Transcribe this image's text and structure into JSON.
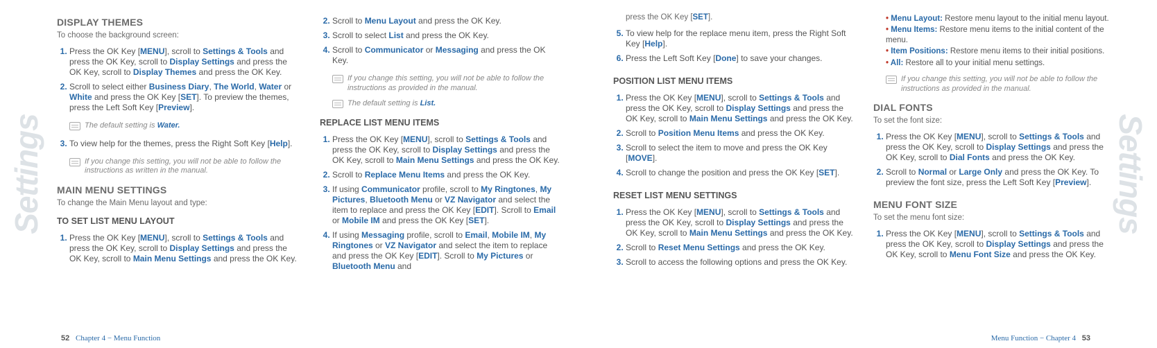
{
  "side_label_left": "Settings",
  "side_label_right": "Settings",
  "page_left_num": "52",
  "page_right_num": "53",
  "footer_left": "Chapter 4 − Menu Function",
  "footer_right": "Menu Function − Chapter 4",
  "dt_title": "DISPLAY THEMES",
  "dt_lead": "To choose the background screen:",
  "dt_s1_a": "Press the OK Key [",
  "dt_s1_b": "MENU",
  "dt_s1_c": "], scroll to ",
  "dt_s1_d": "Settings & Tools",
  "dt_s1_e": " and press the OK Key, scroll to ",
  "dt_s1_f": "Display Settings",
  "dt_s1_g": " and press the OK Key, scroll to ",
  "dt_s1_h": "Display Themes",
  "dt_s1_i": " and press the OK Key.",
  "dt_s2_a": "Scroll to select either ",
  "dt_s2_b": "Business Diary",
  "dt_s2_c": ", ",
  "dt_s2_d": "The World",
  "dt_s2_e": ", ",
  "dt_s2_f": "Water",
  "dt_s2_g": " or ",
  "dt_s2_h": "White",
  "dt_s2_i": " and press the OK Key [",
  "dt_s2_j": "SET",
  "dt_s2_k": "]. To preview the themes, press the Left Soft Key [",
  "dt_s2_l": "Preview",
  "dt_s2_m": "].",
  "dt_note1a": "The default setting is ",
  "dt_note1b": "Water.",
  "dt_s3_a": "To view help for the themes, press the Right Soft Key [",
  "dt_s3_b": "Help",
  "dt_s3_c": "].",
  "dt_note2": "If you change this setting, you will not be able to follow the instructions as written in the manual.",
  "mm_title": "MAIN MENU SETTINGS",
  "mm_lead": "To change the Main Menu layout and type:",
  "mm_sub1": "TO SET LIST MENU LAYOUT",
  "mm1_s1_a": "Press the OK Key [",
  "mm1_s1_b": "MENU",
  "mm1_s1_c": "], scroll to ",
  "mm1_s1_d": "Settings & Tools",
  "mm1_s1_e": " and press the OK Key, scroll to ",
  "mm1_s1_f": "Display Settings",
  "mm1_s1_g": " and press the OK Key, scroll to ",
  "mm1_s1_h": "Main Menu Settings",
  "mm1_s1_i": " and press the OK Key.",
  "mm1_s2_a": "Scroll to ",
  "mm1_s2_b": "Menu Layout",
  "mm1_s2_c": " and press the OK Key.",
  "mm1_s3_a": "Scroll to select ",
  "mm1_s3_b": "List",
  "mm1_s3_c": " and press the OK Key.",
  "mm1_s4_a": "Scroll to ",
  "mm1_s4_b": "Communicator",
  "mm1_s4_c": " or ",
  "mm1_s4_d": "Messaging",
  "mm1_s4_e": " and press the OK Key.",
  "mm1_note1": "If you change this setting, you will not be able to follow the instructions as provided in the manual.",
  "mm1_note2a": "The default setting is ",
  "mm1_note2b": "List.",
  "rl_title": "REPLACE LIST MENU ITEMS",
  "rl_s1_a": "Press the OK Key [",
  "rl_s1_b": "MENU",
  "rl_s1_c": "], scroll to ",
  "rl_s1_d": "Settings & Tools",
  "rl_s1_e": " and press the OK Key, scroll to ",
  "rl_s1_f": "Display Settings",
  "rl_s1_g": " and press the OK Key, scroll to ",
  "rl_s1_h": "Main Menu Settings",
  "rl_s1_i": " and press the OK Key.",
  "rl_s2_a": "Scroll to ",
  "rl_s2_b": "Replace Menu Items",
  "rl_s2_c": " and press the OK Key.",
  "rl_s3_a": "If using ",
  "rl_s3_b": "Communicator",
  "rl_s3_c": " profile, scroll to ",
  "rl_s3_d": "My Ringtones",
  "rl_s3_e": ", ",
  "rl_s3_f": "My Pictures",
  "rl_s3_g": ", ",
  "rl_s3_h": "Bluetooth Menu",
  "rl_s3_i": " or ",
  "rl_s3_j": "VZ Navigator",
  "rl_s3_k": " and select the item to replace and press the OK Key [",
  "rl_s3_l": "EDIT",
  "rl_s3_m": "]. Scroll to ",
  "rl_s3_n": "Email",
  "rl_s3_o": " or ",
  "rl_s3_p": "Mobile IM",
  "rl_s3_q": " and press the OK Key [",
  "rl_s3_r": "SET",
  "rl_s3_s": "].",
  "rl_s4_a": "If using ",
  "rl_s4_b": "Messaging",
  "rl_s4_c": " profile, scroll to ",
  "rl_s4_d": "Email",
  "rl_s4_e": ", ",
  "rl_s4_f": "Mobile IM",
  "rl_s4_g": ", ",
  "rl_s4_h": "My Ringtones",
  "rl_s4_i": " or ",
  "rl_s4_j": "VZ Navigator",
  "rl_s4_k": " and select the item to replace and press the OK Key [",
  "rl_s4_l": "EDIT",
  "rl_s4_m": "]. Scroll to ",
  "rl_s4_n": "My Pictures",
  "rl_s4_o": " or ",
  "rl_s4_p": "Bluetooth Menu",
  "rl_s4_q": " and ",
  "rl_cont_a": "press the OK Key [",
  "rl_cont_b": "SET",
  "rl_cont_c": "].",
  "rl_s5_a": "To view help for the replace menu item, press the Right Soft Key [",
  "rl_s5_b": "Help",
  "rl_s5_c": "].",
  "rl_s6_a": "Press the Left Soft Key [",
  "rl_s6_b": "Done",
  "rl_s6_c": "] to save your changes.",
  "pl_title": "POSITION LIST MENU ITEMS",
  "pl_s1_a": "Press the OK Key [",
  "pl_s1_b": "MENU",
  "pl_s1_c": "], scroll to ",
  "pl_s1_d": "Settings & Tools",
  "pl_s1_e": " and press the OK Key, scroll to ",
  "pl_s1_f": "Display Settings",
  "pl_s1_g": " and press the OK Key, scroll to ",
  "pl_s1_h": "Main Menu Settings",
  "pl_s1_i": " and press the OK Key.",
  "pl_s2_a": "Scroll to ",
  "pl_s2_b": "Position Menu Items",
  "pl_s2_c": " and press the OK Key.",
  "pl_s3_a": "Scroll to select the item to move and press the OK Key [",
  "pl_s3_b": "MOVE",
  "pl_s3_c": "].",
  "pl_s4_a": "Scroll to change the position and press the OK Key [",
  "pl_s4_b": "SET",
  "pl_s4_c": "].",
  "rs_title": "RESET LIST MENU SETTINGS",
  "rs_s1_a": "Press the OK Key [",
  "rs_s1_b": "MENU",
  "rs_s1_c": "], scroll to ",
  "rs_s1_d": "Settings & Tools",
  "rs_s1_e": " and press the OK Key, scroll to ",
  "rs_s1_f": "Display Settings",
  "rs_s1_g": " and press the OK Key, scroll to ",
  "rs_s1_h": "Main Menu Settings",
  "rs_s1_i": " and press the OK Key.",
  "rs_s2_a": "Scroll to ",
  "rs_s2_b": "Reset Menu Settings",
  "rs_s2_c": " and press the OK Key.",
  "rs_s3": "Scroll to access the following options and press the OK Key.",
  "rs_b1a": "Menu Layout:",
  "rs_b1b": " Restore menu layout to the initial menu layout.",
  "rs_b2a": "Menu Items:",
  "rs_b2b": " Restore menu items to the initial content of the menu.",
  "rs_b3a": "Item Positions:",
  "rs_b3b": " Restore menu items to their initial positions.",
  "rs_b4a": "All:",
  "rs_b4b": " Restore all to your initial menu settings.",
  "rs_note": "If you change this setting, you will not be able to follow the instructions as provided in the manual.",
  "df_title": "DIAL FONTS",
  "df_lead": "To set the font size:",
  "df_s1_a": "Press the OK Key [",
  "df_s1_b": "MENU",
  "df_s1_c": "], scroll to ",
  "df_s1_d": "Settings & Tools",
  "df_s1_e": " and press the OK Key, scroll to ",
  "df_s1_f": "Display Settings",
  "df_s1_g": " and press the OK Key, scroll to ",
  "df_s1_h": "Dial Fonts",
  "df_s1_i": " and press the OK Key.",
  "df_s2_a": "Scroll to ",
  "df_s2_b": "Normal",
  "df_s2_c": " or ",
  "df_s2_d": "Large Only",
  "df_s2_e": " and press the OK Key. To preview the font size, press the Left Soft Key [",
  "df_s2_f": "Preview",
  "df_s2_g": "].",
  "mf_title": "MENU FONT SIZE",
  "mf_lead": "To set the menu font size:",
  "mf_s1_a": "Press the OK Key [",
  "mf_s1_b": "MENU",
  "mf_s1_c": "], scroll to ",
  "mf_s1_d": "Settings & Tools",
  "mf_s1_e": " and press the OK Key, scroll to ",
  "mf_s1_f": "Display Settings",
  "mf_s1_g": " and press the OK Key, scroll to ",
  "mf_s1_h": "Menu Font Size",
  "mf_s1_i": " and press the OK Key."
}
